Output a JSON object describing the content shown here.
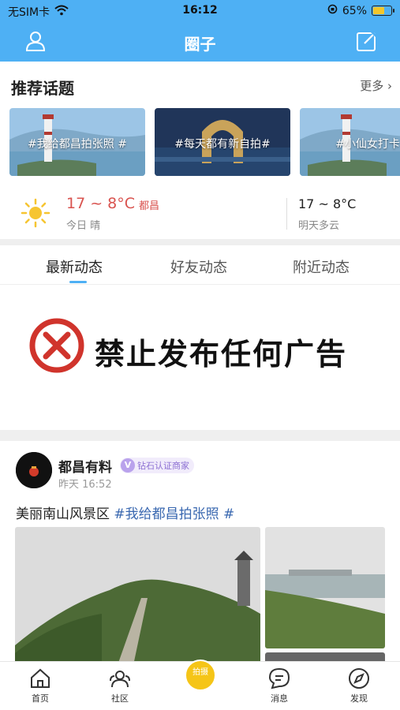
{
  "status_bar": {
    "carrier": "无SIM卡",
    "time": "16:12",
    "battery": "65%",
    "battery_level": 0.65
  },
  "nav": {
    "title": "圈子"
  },
  "topics_section": {
    "heading": "推荐话题",
    "more": "更多",
    "items": [
      {
        "label": "#我给都昌拍张照 #"
      },
      {
        "label": "#每天都有新自拍#"
      },
      {
        "label": "#小仙女打卡"
      }
    ]
  },
  "weather": {
    "today_temp": "17 ~ 8°C",
    "city": "都昌",
    "today_desc": "今日 晴",
    "tomorrow_temp": "17 ~ 8°C",
    "tomorrow_desc": "明天多云"
  },
  "feed_tabs": [
    {
      "label": "最新动态"
    },
    {
      "label": "好友动态"
    },
    {
      "label": "附近动态"
    }
  ],
  "banner": {
    "text": "禁止发布任何广告"
  },
  "post": {
    "author": "都昌有料",
    "badge": "钻石认证商家",
    "badge_v": "V",
    "time": "昨天 16:52",
    "text": "美丽南山风景区",
    "tag": "#我给都昌拍张照 #"
  },
  "tabbar": {
    "items": [
      {
        "label": "首页"
      },
      {
        "label": "社区"
      },
      {
        "label": "消息"
      },
      {
        "label": "发现"
      }
    ],
    "center_label": "拍摄"
  },
  "colors": {
    "brand": "#4eb0f4",
    "temp_red": "#d9534f",
    "tag_blue": "#3a68b0",
    "center_yellow": "#f5c518"
  }
}
